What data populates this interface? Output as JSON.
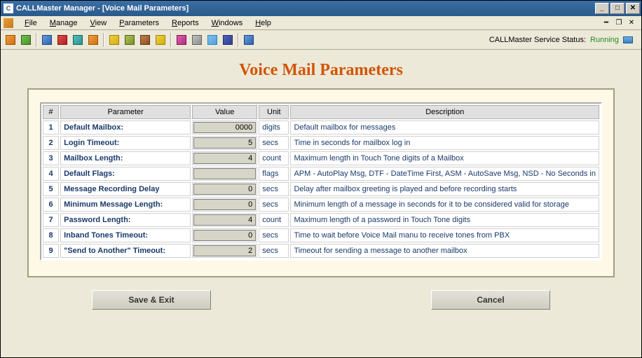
{
  "window": {
    "title": "CALLMaster Manager - [Voice Mail Parameters]"
  },
  "menubar": {
    "items": [
      {
        "label": "File",
        "u": "F"
      },
      {
        "label": "Manage",
        "u": "M"
      },
      {
        "label": "View",
        "u": "V"
      },
      {
        "label": "Parameters",
        "u": "P"
      },
      {
        "label": "Reports",
        "u": "R"
      },
      {
        "label": "Windows",
        "u": "W"
      },
      {
        "label": "Help",
        "u": "H"
      }
    ]
  },
  "status": {
    "label": "CALLMaster Service Status:",
    "value": "Running"
  },
  "page": {
    "title": "Voice Mail Parameters"
  },
  "grid": {
    "headers": {
      "num": "#",
      "parameter": "Parameter",
      "value": "Value",
      "unit": "Unit",
      "description": "Description"
    },
    "rows": [
      {
        "num": "1",
        "parameter": "Default Mailbox:",
        "value": "0000",
        "unit": "digits",
        "description": "Default mailbox for messages"
      },
      {
        "num": "2",
        "parameter": "Login Timeout:",
        "value": "5",
        "unit": "secs",
        "description": "Time in seconds for mailbox log in"
      },
      {
        "num": "3",
        "parameter": "Mailbox Length:",
        "value": "4",
        "unit": "count",
        "description": "Maximum length in Touch Tone digits of a Mailbox"
      },
      {
        "num": "4",
        "parameter": "Default Flags:",
        "value": "",
        "unit": "flags",
        "description": "APM - AutoPlay Msg, DTF - DateTime First, ASM - AutoSave Msg, NSD - No Seconds in"
      },
      {
        "num": "5",
        "parameter": "Message Recording Delay",
        "value": "0",
        "unit": "secs",
        "description": "Delay after mailbox greeting is played and before recording starts"
      },
      {
        "num": "6",
        "parameter": "Minimum Message Length:",
        "value": "0",
        "unit": "secs",
        "description": "Minimum length of a message in seconds for it to be considered valid for storage"
      },
      {
        "num": "7",
        "parameter": "Password Length:",
        "value": "4",
        "unit": "count",
        "description": "Maximum length of a password in Touch Tone digits"
      },
      {
        "num": "8",
        "parameter": "Inband Tones Timeout:",
        "value": "0",
        "unit": "secs",
        "description": "Time to wait before Voice Mail manu to receive tones from PBX"
      },
      {
        "num": "9",
        "parameter": "\"Send to Another\" Timeout:",
        "value": "2",
        "unit": "secs",
        "description": "Timeout for sending a message to another mailbox"
      }
    ]
  },
  "buttons": {
    "save": "Save & Exit",
    "cancel": "Cancel"
  }
}
